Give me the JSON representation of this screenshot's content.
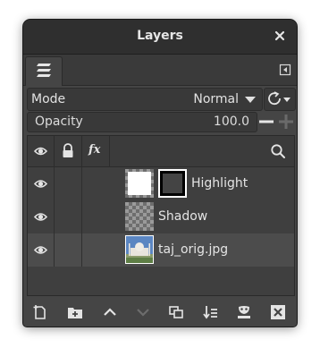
{
  "window": {
    "title": "Layers"
  },
  "icons": {
    "close": "close-icon",
    "tab": "layers-stack-icon",
    "tab_menu": "tab-menu-icon",
    "composite": "composite-mode-icon",
    "visibility": "eye-icon",
    "lock": "lock-icon",
    "effects": "fx-icon",
    "search": "search-icon"
  },
  "mode": {
    "label": "Mode",
    "value": "Normal"
  },
  "opacity": {
    "label": "Opacity",
    "value": "100.0"
  },
  "columns": {
    "effects_label": "fx"
  },
  "layers": [
    {
      "name": "Highlight",
      "visible": true,
      "has_mask": true,
      "selected": false
    },
    {
      "name": "Shadow",
      "visible": true,
      "has_mask": false,
      "selected": false
    },
    {
      "name": "taj_orig.jpg",
      "visible": true,
      "has_mask": false,
      "selected": true
    }
  ],
  "bottom_toolbar": [
    "new-layer-icon",
    "new-layer-group-icon",
    "raise-layer-icon",
    "lower-layer-icon",
    "duplicate-layer-icon",
    "merge-layer-icon",
    "add-mask-icon",
    "delete-layer-icon"
  ],
  "colors": {
    "window_bg": "#454545",
    "titlebar_bg": "#2f2f2f",
    "selected_row": "#4c4c4c",
    "text": "#e4e4e4"
  }
}
